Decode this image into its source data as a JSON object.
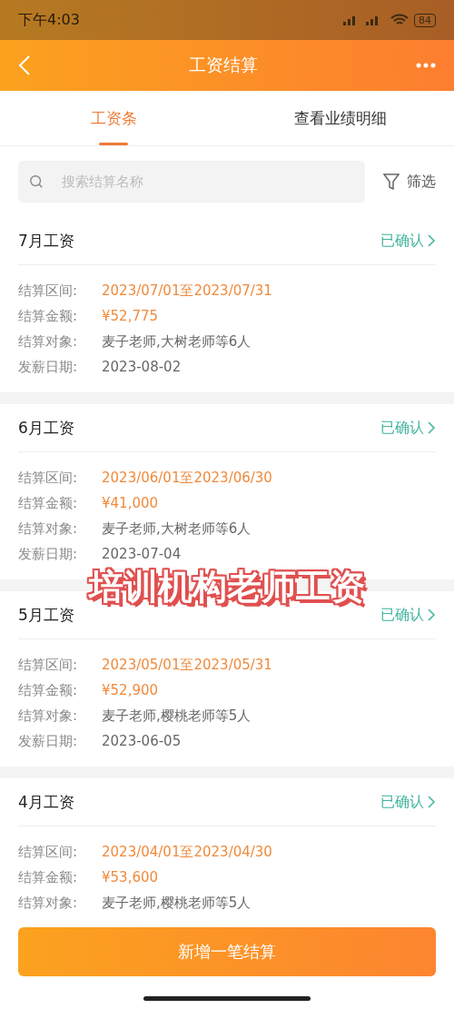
{
  "status_bar": {
    "time": "下午4:03",
    "battery": "84"
  },
  "header": {
    "title": "工资结算"
  },
  "tabs": [
    {
      "label": "工资条",
      "selected": true
    },
    {
      "label": "查看业绩明细",
      "selected": false
    }
  ],
  "search": {
    "placeholder": "搜索结算名称"
  },
  "filter": {
    "label": "筛选"
  },
  "settlements": [
    {
      "title": "7月工资",
      "status": "已确认",
      "rows": [
        {
          "label": "结算区间:",
          "value": "2023/07/01至2023/07/31",
          "highlight": true
        },
        {
          "label": "结算金额:",
          "value": "¥52,775",
          "highlight": true
        },
        {
          "label": "结算对象:",
          "value": "麦子老师,大树老师等6人",
          "highlight": false
        },
        {
          "label": "发薪日期:",
          "value": "2023-08-02",
          "highlight": false
        }
      ]
    },
    {
      "title": "6月工资",
      "status": "已确认",
      "rows": [
        {
          "label": "结算区间:",
          "value": "2023/06/01至2023/06/30",
          "highlight": true
        },
        {
          "label": "结算金额:",
          "value": "¥41,000",
          "highlight": true
        },
        {
          "label": "结算对象:",
          "value": "麦子老师,大树老师等6人",
          "highlight": false
        },
        {
          "label": "发薪日期:",
          "value": "2023-07-04",
          "highlight": false
        }
      ]
    },
    {
      "title": "5月工资",
      "status": "已确认",
      "rows": [
        {
          "label": "结算区间:",
          "value": "2023/05/01至2023/05/31",
          "highlight": true
        },
        {
          "label": "结算金额:",
          "value": "¥52,900",
          "highlight": true
        },
        {
          "label": "结算对象:",
          "value": "麦子老师,樱桃老师等5人",
          "highlight": false
        },
        {
          "label": "发薪日期:",
          "value": "2023-06-05",
          "highlight": false
        }
      ]
    },
    {
      "title": "4月工资",
      "status": "已确认",
      "rows": [
        {
          "label": "结算区间:",
          "value": "2023/04/01至2023/04/30",
          "highlight": true
        },
        {
          "label": "结算金额:",
          "value": "¥53,600",
          "highlight": true
        },
        {
          "label": "结算对象:",
          "value": "麦子老师,樱桃老师等5人",
          "highlight": false
        }
      ]
    }
  ],
  "overlay_caption": "培训机构老师工资",
  "primary_button": "新增一笔结算"
}
